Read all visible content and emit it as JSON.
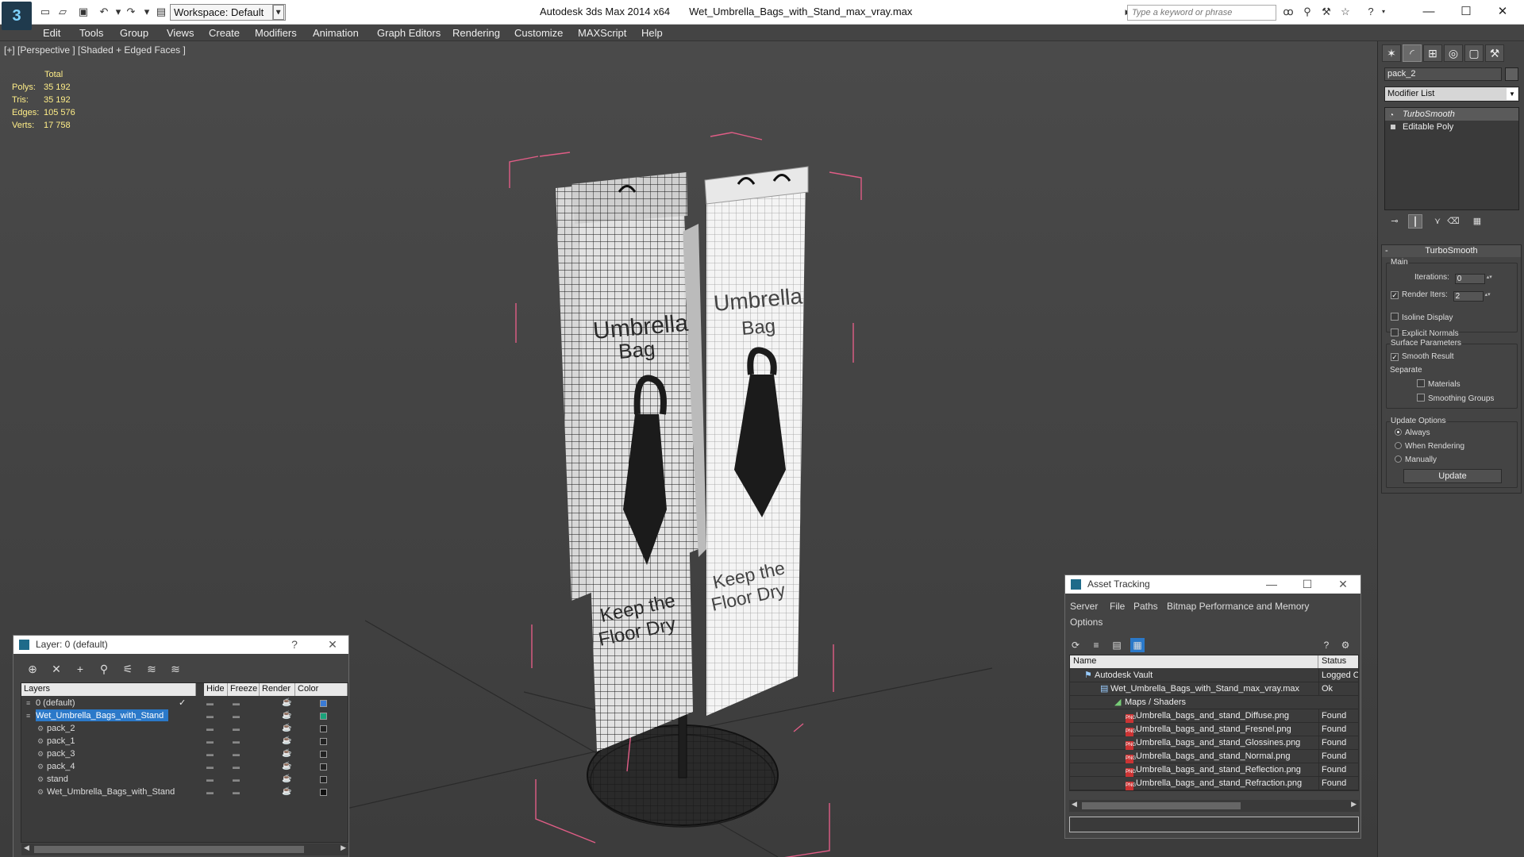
{
  "app": {
    "title": "Autodesk 3ds Max  2014 x64",
    "file": "Wet_Umbrella_Bags_with_Stand_max_vray.max",
    "logo_icon": "3dsmax-logo-icon"
  },
  "toolbar": {
    "workspace": "Workspace: Default",
    "search_placeholder": "Type a keyword or phrase"
  },
  "menu": [
    "Edit",
    "Tools",
    "Group",
    "Views",
    "Create",
    "Modifiers",
    "Animation",
    "Graph Editors",
    "Rendering",
    "Customize",
    "MAXScript",
    "Help"
  ],
  "viewport": {
    "label": "[+] [Perspective ] [Shaded + Edged Faces ]",
    "stats": {
      "header": "Total",
      "rows": [
        {
          "label": "Polys:",
          "value": "35 192"
        },
        {
          "label": "Tris:",
          "value": "35 192"
        },
        {
          "label": "Edges:",
          "value": "105 576"
        },
        {
          "label": "Verts:",
          "value": "17 758"
        }
      ]
    },
    "bag_left_text": [
      "Umbrella",
      "Bag",
      "Keep the",
      "Floor Dry"
    ],
    "bag_right_text": [
      "Umbrella",
      "Bag",
      "Keep the",
      "Floor Dry"
    ]
  },
  "command_panel": {
    "object_name": "pack_2",
    "modifier_list": "Modifier List",
    "stack": [
      {
        "label": "TurboSmooth",
        "selected": true
      },
      {
        "label": "Editable Poly",
        "selected": false
      }
    ],
    "rollout": {
      "title": "TurboSmooth",
      "main_label": "Main",
      "iterations_label": "Iterations:",
      "iterations_value": "0",
      "render_iters_label": "Render Iters:",
      "render_iters_value": "2",
      "isoline_label": "Isoline Display",
      "explicit_normals_label": "Explicit Normals",
      "surface_params_label": "Surface Parameters",
      "smooth_result_label": "Smooth Result",
      "separate_label": "Separate",
      "materials_label": "Materials",
      "smoothing_groups_label": "Smoothing Groups",
      "update_options_label": "Update Options",
      "always_label": "Always",
      "when_rendering_label": "When Rendering",
      "manually_label": "Manually",
      "update_button": "Update"
    }
  },
  "layer_dialog": {
    "title": "Layer: 0 (default)",
    "help": "?",
    "columns": [
      "Layers",
      "Hide",
      "Freeze",
      "Render",
      "Color"
    ],
    "rows": [
      {
        "name": "0 (default)",
        "indent": 1,
        "color": "#3a7bd5",
        "selected": false,
        "check": "✓"
      },
      {
        "name": "Wet_Umbrella_Bags_with_Stand",
        "indent": 1,
        "color": "#1aa37a",
        "selected": true,
        "check": ""
      },
      {
        "name": "pack_2",
        "indent": 2,
        "color": "#222222",
        "selected": false,
        "check": ""
      },
      {
        "name": "pack_1",
        "indent": 2,
        "color": "#222222",
        "selected": false,
        "check": ""
      },
      {
        "name": "pack_3",
        "indent": 2,
        "color": "#222222",
        "selected": false,
        "check": ""
      },
      {
        "name": "pack_4",
        "indent": 2,
        "color": "#222222",
        "selected": false,
        "check": ""
      },
      {
        "name": "stand",
        "indent": 2,
        "color": "#222222",
        "selected": false,
        "check": ""
      },
      {
        "name": "Wet_Umbrella_Bags_with_Stand",
        "indent": 2,
        "color": "#111111",
        "selected": false,
        "check": ""
      }
    ]
  },
  "asset_dialog": {
    "title": "Asset Tracking",
    "menu": [
      "Server",
      "File",
      "Paths",
      "Bitmap Performance and Memory",
      "Options"
    ],
    "columns": [
      "Name",
      "Status"
    ],
    "rows": [
      {
        "name": "Autodesk Vault",
        "status": "Logged O",
        "indent": 1,
        "kind": "vault"
      },
      {
        "name": "Wet_Umbrella_Bags_with_Stand_max_vray.max",
        "status": "Ok",
        "indent": 2,
        "kind": "max"
      },
      {
        "name": "Maps / Shaders",
        "status": "",
        "indent": 3,
        "kind": "folder"
      },
      {
        "name": "Umbrella_bags_and_stand_Diffuse.png",
        "status": "Found",
        "indent": 4,
        "kind": "png"
      },
      {
        "name": "Umbrella_bags_and_stand_Fresnel.png",
        "status": "Found",
        "indent": 4,
        "kind": "png"
      },
      {
        "name": "Umbrella_bags_and_stand_Glossines.png",
        "status": "Found",
        "indent": 4,
        "kind": "png"
      },
      {
        "name": "Umbrella_bags_and_stand_Normal.png",
        "status": "Found",
        "indent": 4,
        "kind": "png"
      },
      {
        "name": "Umbrella_bags_and_stand_Reflection.png",
        "status": "Found",
        "indent": 4,
        "kind": "png"
      },
      {
        "name": "Umbrella_bags_and_stand_Refraction.png",
        "status": "Found",
        "indent": 4,
        "kind": "png"
      }
    ],
    "file_icon_label": "PNG"
  }
}
